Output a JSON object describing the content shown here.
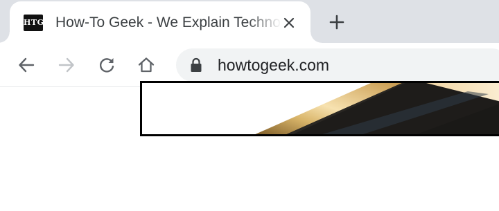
{
  "tab": {
    "favicon_text": "HTG",
    "title": "How-To Geek - We Explain Technology",
    "close_icon": "close-icon"
  },
  "tabstrip": {
    "new_tab_icon": "plus-icon"
  },
  "toolbar": {
    "back_icon": "arrow-left-icon",
    "forward_icon": "arrow-right-icon",
    "reload_icon": "reload-icon",
    "home_icon": "home-icon"
  },
  "omnibox": {
    "security_icon": "lock-icon",
    "url": "howtogeek.com"
  },
  "colors": {
    "tabstrip_bg": "#dee1e6",
    "omnibox_bg": "#f1f3f4",
    "icon": "#5f6368",
    "icon_disabled": "#c1c4c8"
  }
}
